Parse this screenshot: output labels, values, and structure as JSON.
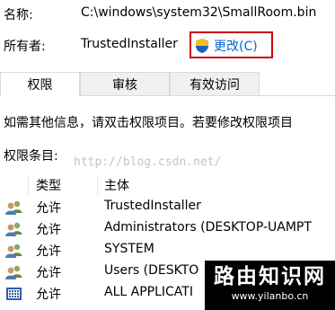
{
  "fields": {
    "name_label": "名称:",
    "name_value": "C:\\windows\\system32\\SmallRoom.bin",
    "owner_label": "所有者:",
    "owner_value": "TrustedInstaller",
    "change_label": "更改(C)"
  },
  "tabs": [
    {
      "label": "权限"
    },
    {
      "label": "审核"
    },
    {
      "label": "有效访问"
    }
  ],
  "info_text": "如需其他信息，请双击权限项目。若要修改权限项目",
  "entries_label": "权限条目:",
  "watermark": "http://blog.csdn.net/",
  "list": {
    "col_type": "类型",
    "col_principal": "主体",
    "rows": [
      {
        "icon": "users-icon",
        "type": "允许",
        "principal": "TrustedInstaller"
      },
      {
        "icon": "users-icon",
        "type": "允许",
        "principal": "Administrators (DESKTOP-UAMPT"
      },
      {
        "icon": "users-icon",
        "type": "允许",
        "principal": "SYSTEM"
      },
      {
        "icon": "users-icon",
        "type": "允许",
        "principal": "Users (DESKTO"
      },
      {
        "icon": "app-package-icon",
        "type": "允许",
        "principal": "ALL APPLICATI"
      }
    ]
  },
  "brand": {
    "title": "路由知识网",
    "url": "www.yilanbo.cn"
  },
  "colors": {
    "link": "#0066cc",
    "highlight_border": "#cc0000",
    "tab_border": "#d9d9d9"
  }
}
